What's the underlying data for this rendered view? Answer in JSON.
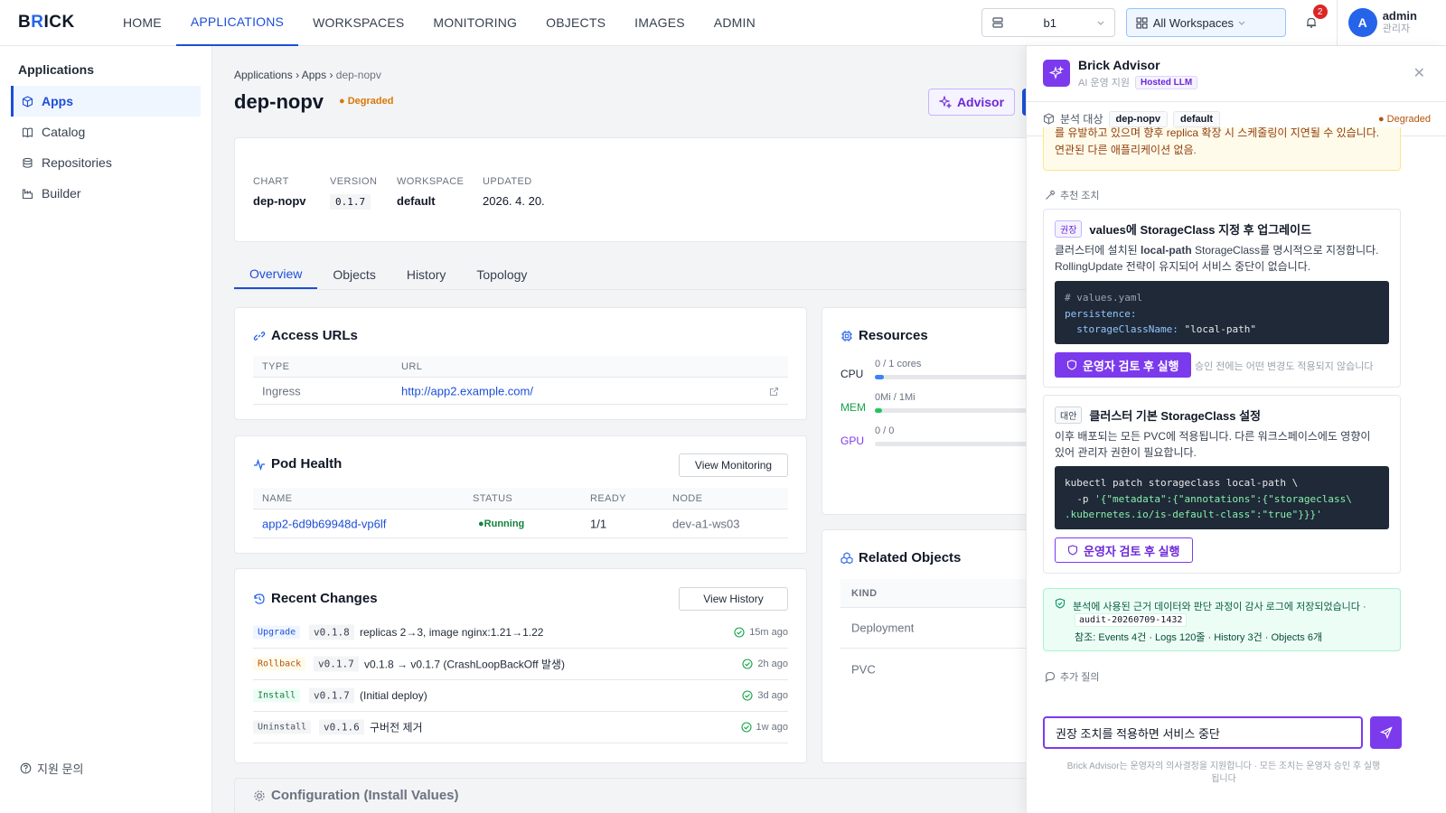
{
  "brand": {
    "logo_prefix": "B",
    "logo_accent": "R",
    "logo_rest": "ICK"
  },
  "nav": {
    "items": [
      {
        "label": "HOME"
      },
      {
        "label": "APPLICATIONS"
      },
      {
        "label": "WORKSPACES"
      },
      {
        "label": "MONITORING"
      },
      {
        "label": "OBJECTS"
      },
      {
        "label": "IMAGES"
      },
      {
        "label": "ADMIN"
      }
    ],
    "active": "APPLICATIONS",
    "cluster": "b1",
    "workspace": "All Workspaces",
    "notification_count": "2",
    "user": {
      "initial": "A",
      "name": "admin",
      "role": "관리자"
    }
  },
  "sidebar": {
    "title": "Applications",
    "items": [
      {
        "label": "Apps",
        "icon": "cube-icon"
      },
      {
        "label": "Catalog",
        "icon": "book-icon"
      },
      {
        "label": "Repositories",
        "icon": "database-icon"
      },
      {
        "label": "Builder",
        "icon": "factory-icon"
      }
    ],
    "support": "지원 문의"
  },
  "app": {
    "breadcrumb": [
      "Applications",
      "Apps",
      "dep-nopv"
    ],
    "breadcrumb_sep": "›",
    "name": "dep-nopv",
    "status": "Degraded",
    "advisor_button": "Advisor",
    "meta": {
      "chart_label": "CHART",
      "chart": "dep-nopv",
      "version_label": "VERSION",
      "version": "0.1.7",
      "workspace_label": "WORKSPACE",
      "workspace": "default",
      "updated_label": "UPDATED",
      "updated": "2026. 4. 20."
    },
    "tabs": [
      "Overview",
      "Objects",
      "History",
      "Topology"
    ]
  },
  "access_urls": {
    "title": "Access URLs",
    "columns": [
      "TYPE",
      "URL"
    ],
    "rows": [
      {
        "type": "Ingress",
        "url": "http://app2.example.com/"
      }
    ]
  },
  "pod_health": {
    "title": "Pod Health",
    "button": "View Monitoring",
    "columns": [
      "NAME",
      "STATUS",
      "READY",
      "NODE"
    ],
    "rows": [
      {
        "name": "app2-6d9b69948d-vp6lf",
        "status": "Running",
        "ready": "1/1",
        "node": "dev-a1-ws03"
      }
    ]
  },
  "recent_changes": {
    "title": "Recent Changes",
    "button": "View History",
    "rows": [
      {
        "type": "Upgrade",
        "version": "v0.1.8",
        "desc": "replicas 2→3, image nginx:1.21→1.22",
        "ago": "15m ago"
      },
      {
        "type": "Rollback",
        "version": "v0.1.7",
        "desc": "v0.1.8 → v0.1.7 (CrashLoopBackOff 발생)",
        "ago": "2h ago"
      },
      {
        "type": "Install",
        "version": "v0.1.7",
        "desc": "(Initial deploy)",
        "ago": "3d ago"
      },
      {
        "type": "Uninstall",
        "version": "v0.1.6",
        "desc": "구버전 제거",
        "ago": "1w ago"
      }
    ]
  },
  "resources": {
    "title": "Resources",
    "rows": [
      {
        "label": "CPU",
        "value": "0 / 1 cores",
        "fill": 0.04,
        "color": "#3b82f6"
      },
      {
        "label": "MEM",
        "value": "0Mi / 1Mi",
        "fill": 0.02,
        "color": "#22c55e"
      },
      {
        "label": "GPU",
        "value": "0 / 0",
        "fill": 0.0,
        "color": "#8b5cf6"
      }
    ]
  },
  "related": {
    "title": "Related Objects",
    "column": "KIND",
    "rows": [
      "Deployment",
      "PVC"
    ]
  },
  "config": {
    "title": "Configuration (Install Values)"
  },
  "advisor": {
    "title": "Brick Advisor",
    "subtitle": "AI 운영 지원",
    "llm_badge": "Hosted LLM",
    "target_label": "분석 대상",
    "target_app": "dep-nopv",
    "target_ws": "default",
    "target_status": "Degraded",
    "warn_line1": "를 유발하고 있으며 향후 replica 확장 시 스케줄링이 지연될 수 있습니다.",
    "warn_line2": "연관된 다른 애플리케이션 없음.",
    "recommend_label": "추천 조치",
    "rec1": {
      "tag": "권장",
      "title": "values에 StorageClass 지정 후 업그레이드",
      "desc1_pre": "클러스터에 설치된 ",
      "desc1_bold": "local-path",
      "desc1_post": " StorageClass를 명시적으로 지정합니다.",
      "desc2": "RollingUpdate 전략이 유지되어 서비스 중단이 없습니다.",
      "code_comment": "# values.yaml",
      "code_key1": "persistence:",
      "code_key2": "storageClassName:",
      "code_val": "\"local-path\"",
      "button": "운영자 검토 후 실행",
      "note": "승인 전에는 어떤 변경도 적용되지 않습니다"
    },
    "rec2": {
      "tag": "대안",
      "title": "클러스터 기본 StorageClass 설정",
      "desc1": "이후 배포되는 모든 PVC에 적용됩니다. 다른 워크스페이스에도 영향이",
      "desc2": "있어 관리자 권한이 필요합니다.",
      "code_line1": "kubectl patch storageclass local-path \\",
      "code_line2_pre": "  -p ",
      "code_line2_str": "'{\"metadata\":{\"annotations\":{\"storageclass\\",
      "code_line3": ".kubernetes.io/is-default-class\":\"true\"}}}'",
      "button": "운영자 검토 후 실행"
    },
    "audit_text": "분석에 사용된 근거 데이터와 판단 과정이 감사 로그에 저장되었습니다 ·",
    "audit_id": "audit-20260709-1432",
    "audit_refs": "참조: Events 4건 · Logs 120줄 · History 3건 · Objects 6개",
    "followup_label": "추가 질의",
    "input_value": "권장 조치를 적용하면 서비스 중단",
    "footer_line1": "Brick Advisor는 운영자의 의사결정을 지원합니다 · 모든 조치는 운영자 승인 후 실행",
    "footer_line2": "됩니다"
  }
}
